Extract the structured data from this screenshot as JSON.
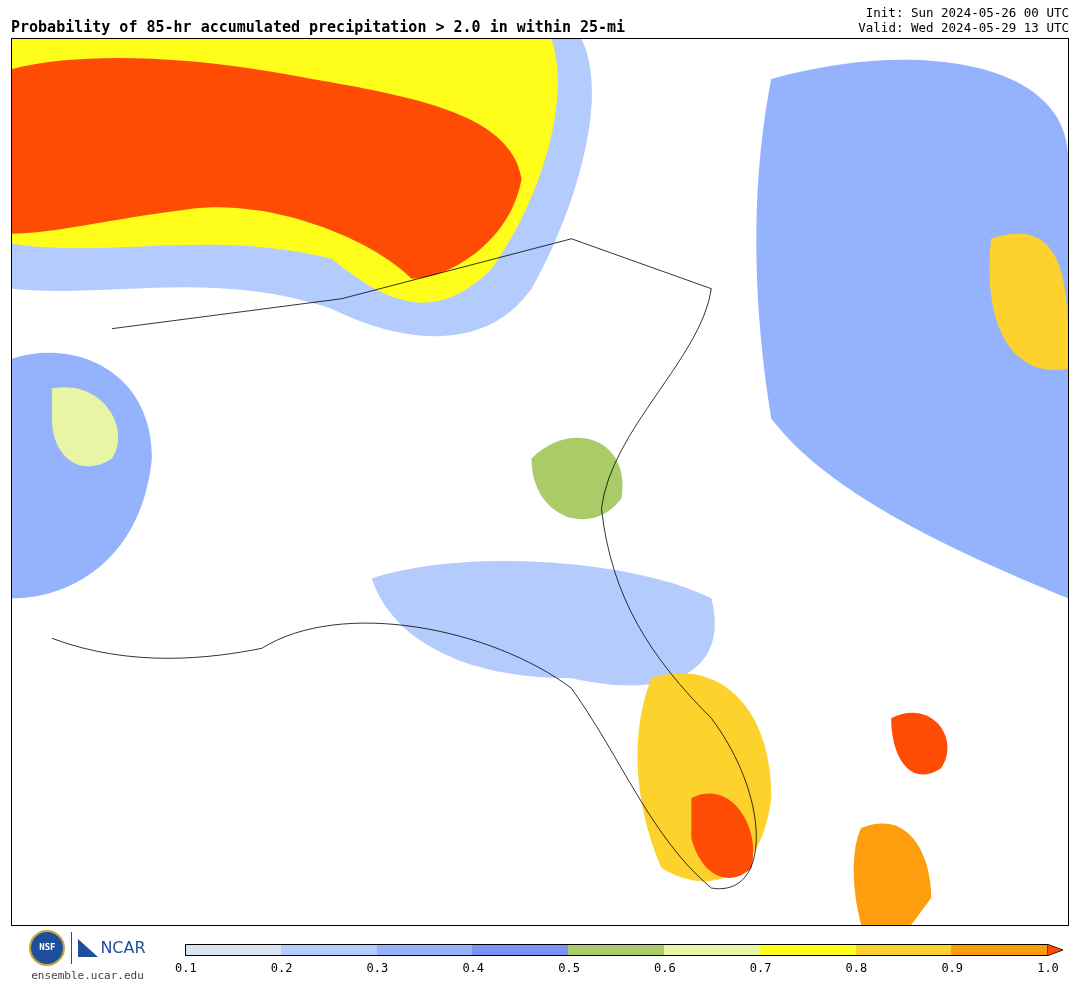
{
  "title": "Probability of 85-hr accumulated precipitation > 2.0 in within 25-mi",
  "init": "Init: Sun 2024-05-26 00 UTC",
  "valid": "Valid: Wed 2024-05-29 13 UTC",
  "logo": {
    "seal": "NSF",
    "name": "NCAR",
    "url": "ensemble.ucar.edu"
  },
  "colorbar": {
    "bins": [
      {
        "kind": "bin",
        "color": "#d9e3ef"
      },
      {
        "kind": "bin",
        "color": "#b3cbfd"
      },
      {
        "kind": "bin",
        "color": "#95b3fd"
      },
      {
        "kind": "bin",
        "color": "#7b93f7"
      },
      {
        "kind": "bin",
        "color": "#a9cc68"
      },
      {
        "kind": "bin",
        "color": "#e8f5a4"
      },
      {
        "kind": "bin",
        "color": "#fefe1a"
      },
      {
        "kind": "bin",
        "color": "#fed22d"
      },
      {
        "kind": "bin",
        "color": "#fe9d0e"
      },
      {
        "kind": "extend",
        "color": "#ff4c05"
      }
    ],
    "ticks": [
      "0.1",
      "0.2",
      "0.3",
      "0.4",
      "0.5",
      "0.6",
      "0.7",
      "0.8",
      "0.9",
      "1.0"
    ]
  }
}
